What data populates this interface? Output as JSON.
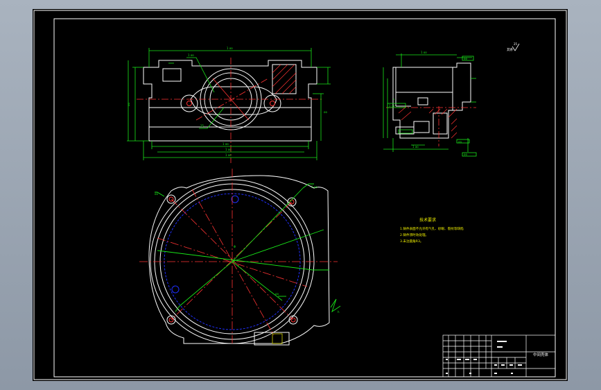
{
  "drawing": {
    "title_block": {
      "drawing_title": "中间壳体"
    },
    "technical_requirements": {
      "heading": "技术要求",
      "lines": [
        "1.铸件表面不允许有气孔、砂眼、裂纹等缺陷",
        "2.铸件须时效处理。",
        "3.未注圆角R3。"
      ]
    },
    "roughness_note": "其余"
  },
  "colors": {
    "background": "#000000",
    "outline": "#ffffff",
    "dimension": "#19e619",
    "centerline": "#ff2020",
    "hidden": "#2030ff",
    "section_text": "#f0f000"
  }
}
